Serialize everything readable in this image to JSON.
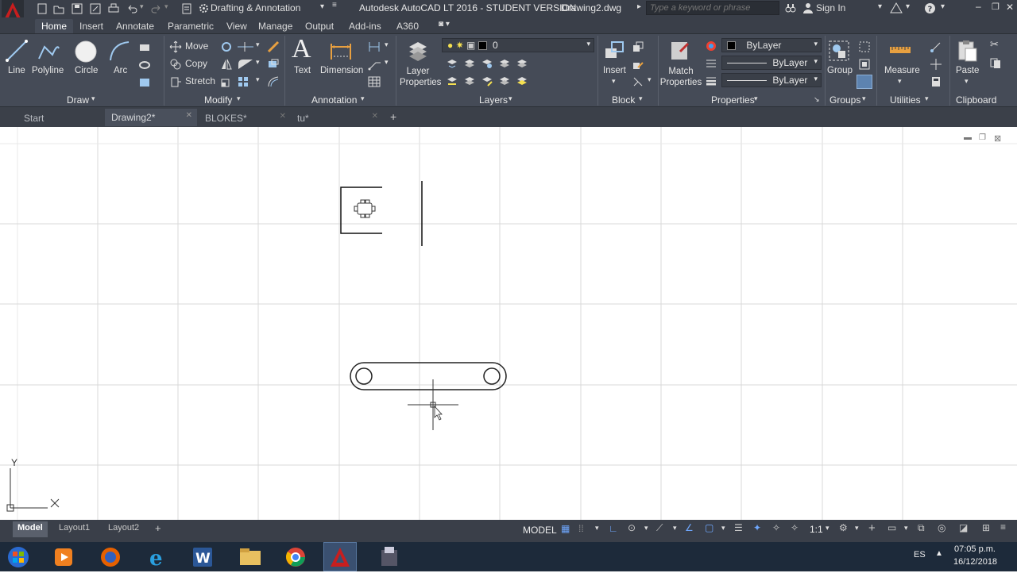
{
  "app": {
    "workspace": "Drafting & Annotation",
    "title": "Autodesk AutoCAD LT 2016 - STUDENT VERSION",
    "filename": "Drawing2.dwg",
    "search_placeholder": "Type a keyword or phrase",
    "sign_in": "Sign In"
  },
  "ribbon_tabs": [
    "Home",
    "Insert",
    "Annotate",
    "Parametric",
    "View",
    "Manage",
    "Output",
    "Add-ins",
    "A360"
  ],
  "ribbon": {
    "draw": {
      "title": "Draw",
      "line": "Line",
      "polyline": "Polyline",
      "circle": "Circle",
      "arc": "Arc"
    },
    "modify": {
      "title": "Modify",
      "move": "Move",
      "copy": "Copy",
      "stretch": "Stretch"
    },
    "annotation": {
      "title": "Annotation",
      "text": "Text",
      "dimension": "Dimension"
    },
    "layers": {
      "title": "Layers",
      "layer_properties": "Layer Properties",
      "current_layer": "0"
    },
    "block": {
      "title": "Block",
      "insert": "Insert"
    },
    "properties": {
      "title": "Properties",
      "match_properties": "Match Properties",
      "color": "ByLayer",
      "linetype": "ByLayer",
      "lineweight": "ByLayer"
    },
    "groups": {
      "title": "Groups",
      "group": "Group"
    },
    "utilities": {
      "title": "Utilities",
      "measure": "Measure"
    },
    "clipboard": {
      "title": "Clipboard",
      "paste": "Paste"
    }
  },
  "doc_tabs": [
    "Start",
    "Drawing2*",
    "BLOKES*",
    "tu*"
  ],
  "ucs": {
    "y": "Y",
    "x": "X"
  },
  "layout_tabs": [
    "Model",
    "Layout1",
    "Layout2"
  ],
  "status": {
    "model": "MODEL",
    "scale": "1:1"
  },
  "taskbar": {
    "lang": "ES",
    "time": "07:05 p.m.",
    "date": "16/12/2018"
  },
  "colors": {
    "ribbon": "#454b57",
    "titlebar": "#3a3f49",
    "accent_red": "#c81e1e"
  }
}
